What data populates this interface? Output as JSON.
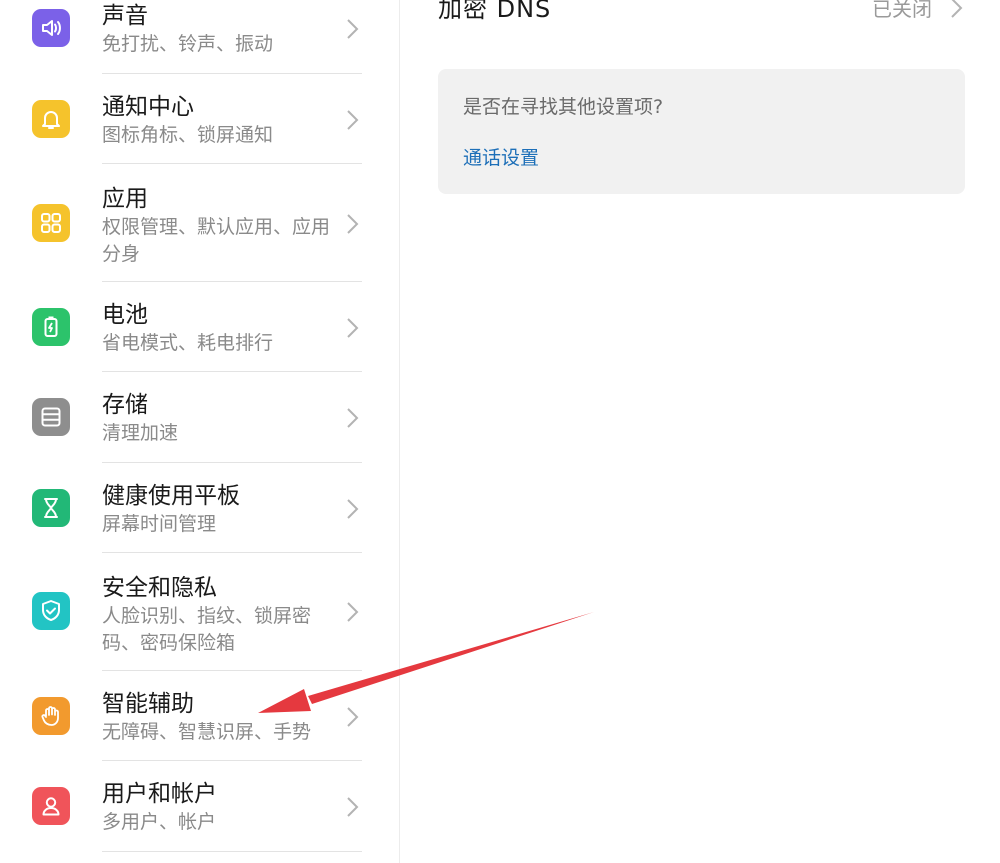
{
  "settings_list": [
    {
      "title": "声音",
      "subtitle": "免打扰、铃声、振动",
      "icon": "speaker-icon",
      "color": "#7b61e8"
    },
    {
      "title": "通知中心",
      "subtitle": "图标角标、锁屏通知",
      "icon": "bell-icon",
      "color": "#f5c32c"
    },
    {
      "title": "应用",
      "subtitle": "权限管理、默认应用、应用分身",
      "icon": "apps-grid-icon",
      "color": "#f5c32c"
    },
    {
      "title": "电池",
      "subtitle": "省电模式、耗电排行",
      "icon": "battery-icon",
      "color": "#2cc36b"
    },
    {
      "title": "存储",
      "subtitle": "清理加速",
      "icon": "storage-icon",
      "color": "#8e8e8e"
    },
    {
      "title": "健康使用平板",
      "subtitle": "屏幕时间管理",
      "icon": "hourglass-icon",
      "color": "#22b877"
    },
    {
      "title": "安全和隐私",
      "subtitle": "人脸识别、指纹、锁屏密码、密码保险箱",
      "icon": "shield-check-icon",
      "color": "#22c4c4"
    },
    {
      "title": "智能辅助",
      "subtitle": "无障碍、智慧识屏、手势",
      "icon": "hand-icon",
      "color": "#f29a2e"
    },
    {
      "title": "用户和帐户",
      "subtitle": "多用户、帐户",
      "icon": "user-icon",
      "color": "#f0545a"
    }
  ],
  "detail": {
    "dns_label": "加密 DNS",
    "dns_status": "已关闭",
    "suggest_question": "是否在寻找其他设置项?",
    "suggest_link": "通话设置"
  },
  "colors": {
    "link": "#1d6fb8",
    "annotation_arrow": "#e5393f"
  }
}
